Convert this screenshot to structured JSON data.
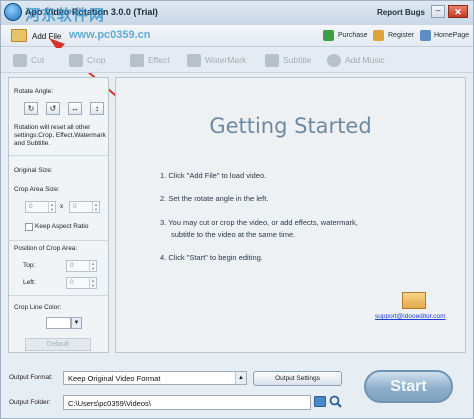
{
  "window": {
    "title": "Apo Video Rotation 3.0.0 (Trial)",
    "report_bugs": "Report Bugs",
    "minimize_symbol": "–",
    "close_symbol": "✕"
  },
  "watermark": {
    "site_cn": "河东软件网",
    "site_url": "www.pc0359.cn"
  },
  "menu": {
    "add_file": "Add File",
    "purchase": "Purchase",
    "register": "Register",
    "homepage": "HomePage"
  },
  "tools": [
    {
      "label": "Cut",
      "icon": "scissors-icon"
    },
    {
      "label": "Crop",
      "icon": "crop-icon"
    },
    {
      "label": "Effect",
      "icon": "effect-icon"
    },
    {
      "label": "WaterMark",
      "icon": "watermark-icon"
    },
    {
      "label": "Subtitle",
      "icon": "subtitle-icon"
    },
    {
      "label": "Add Music",
      "icon": "music-icon"
    }
  ],
  "left_panel": {
    "rotate_angle": "Rotate Angle:",
    "rotate_note": "Rotation will reset all other settings:Crop, Effect,Watermark and Subtitle.",
    "original_size": "Original Size:",
    "crop_area_size": "Crop Area Size:",
    "width_value": "0",
    "x_label": "x",
    "height_value": "0",
    "keep_aspect_ratio": "Keep Aspect Ratio",
    "position_of_crop_area": "Position of Crop Area:",
    "top_label": "Top:",
    "top_value": "0",
    "left_label": "Left:",
    "left_value": "0",
    "crop_line_color": "Crop Line Color:",
    "default_button": "Default"
  },
  "main": {
    "title": "Getting Started",
    "steps": [
      "1. Click \"Add File\" to load video.",
      "2. Set the rotate angle in the left.",
      "3. You may cut or crop the video, or add effects, watermark,",
      "subtitle to the video at the same time.",
      "4. Click \"Start\" to begin editing."
    ],
    "support_email": "support@idooeditor.com"
  },
  "bottom": {
    "output_format_label": "Output Format:",
    "output_format_value": "Keep Original Video Format",
    "output_settings": "Output Settings",
    "output_folder_label": "Output Folder:",
    "output_folder_value": "C:\\Users\\pc0359\\Videos\\",
    "start": "Start"
  },
  "colors": {
    "accent": "#1b6fb5",
    "arrow": "#d7302a",
    "link": "#1a3fd0"
  }
}
